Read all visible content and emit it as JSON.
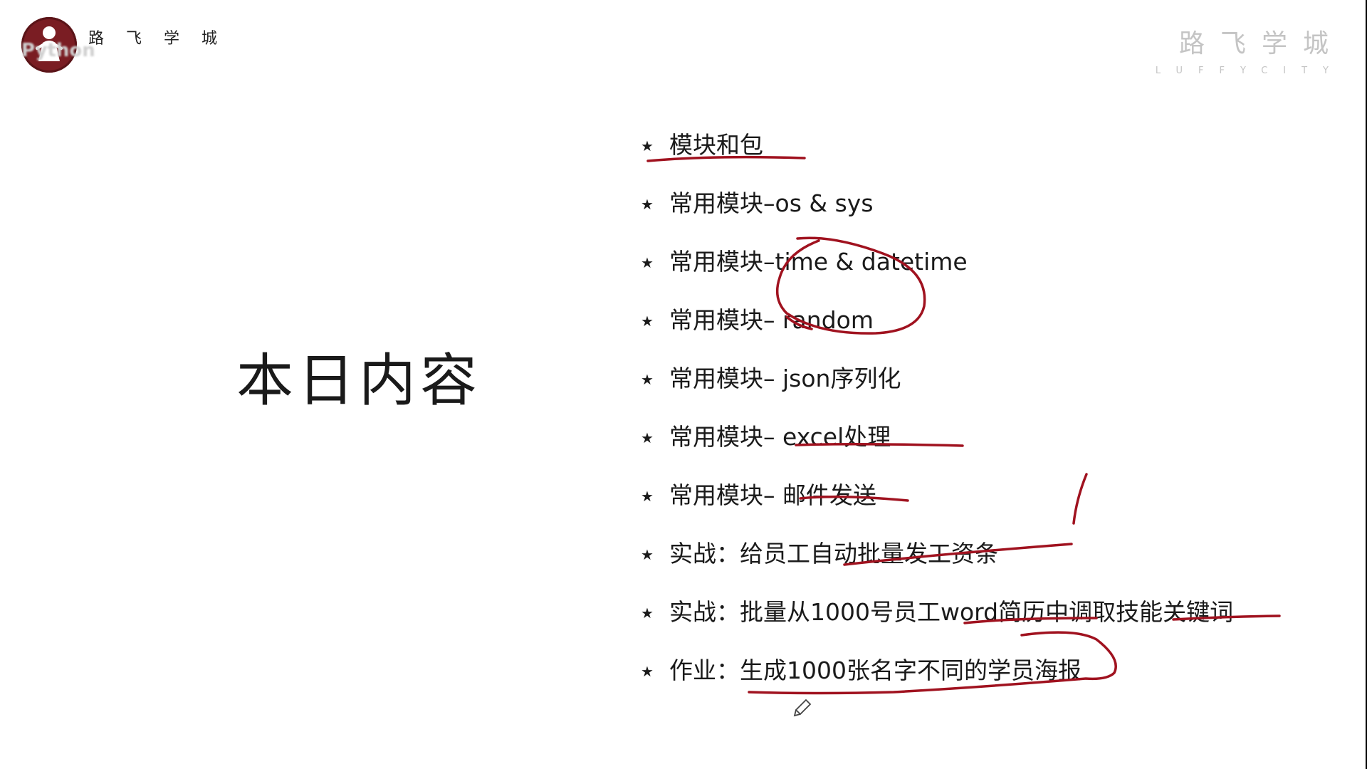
{
  "branding": {
    "logo_text": "路 飞 学 城",
    "overlay_text": "Python",
    "right_cn": "路飞学城",
    "right_en": "LUFFYCITY"
  },
  "slide": {
    "title": "本日内容",
    "bullet_symbol": "★",
    "items": [
      "模块和包",
      "常用模块–os & sys",
      "常用模块–time & datetime",
      "常用模块– random",
      "常用模块– json序列化",
      "常用模块– excel处理",
      "常用模块– 邮件发送",
      "实战：给员工自动批量发工资条",
      "实战：批量从1000号员工word简历中调取技能关键词",
      "作业：生成1000张名字不同的学员海报"
    ]
  },
  "annotations": {
    "ink_color": "#a0121f",
    "pen_cursor_icon": "pencil-icon"
  }
}
